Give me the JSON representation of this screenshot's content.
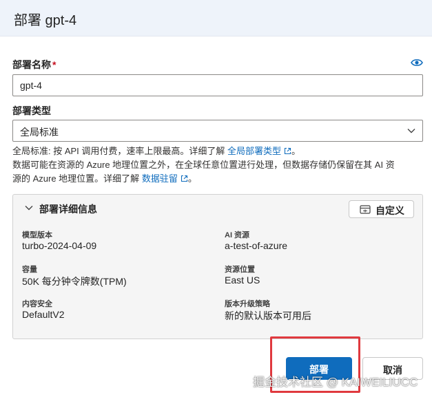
{
  "header": {
    "title": "部署 gpt-4"
  },
  "deployment_name": {
    "label": "部署名称",
    "required_mark": "*",
    "value": "gpt-4",
    "eye_icon": "eye-icon"
  },
  "deployment_type": {
    "label": "部署类型",
    "selected": "全局标准"
  },
  "description": {
    "line1_text": "全局标准: 按 API 调用付费，速率上限最高。详细了解",
    "line1_link": "全局部署类型",
    "line2_text": "数据可能在资源的 Azure 地理位置之外，在全球任意位置进行处理，但数据存储仍保留在其 AI 资",
    "line3_text": "源的 Azure 地理位置。详细了解",
    "line3_link": "数据驻留",
    "link_color": "#0f6cbd"
  },
  "details": {
    "title": "部署详细信息",
    "customize_label": "自定义",
    "fields": {
      "model_version": {
        "key": "模型版本",
        "value": "turbo-2024-04-09"
      },
      "ai_resource": {
        "key": "AI 资源",
        "value": "a-test-of-azure"
      },
      "capacity": {
        "key": "容量",
        "value": "50K 每分钟令牌数(TPM)"
      },
      "resource_location": {
        "key": "资源位置",
        "value": "East US"
      },
      "content_safety": {
        "key": "内容安全",
        "value": "DefaultV2"
      },
      "upgrade_policy": {
        "key": "版本升级策略",
        "value": "新的默认版本可用后"
      }
    }
  },
  "actions": {
    "deploy_label": "部署",
    "cancel_label": "取消",
    "primary_color": "#0f6cbd",
    "highlight_color": "#e0393e"
  },
  "watermark": "掘金技术社区 @ KAIWEILIUCC"
}
